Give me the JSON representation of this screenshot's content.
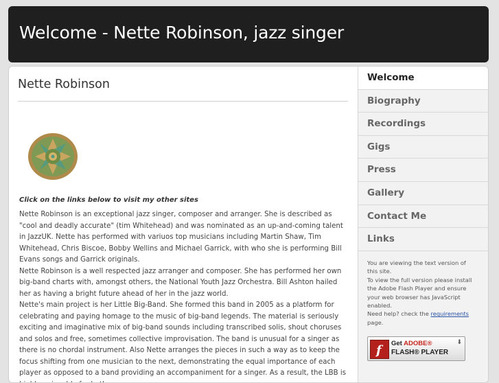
{
  "header": {
    "site_title": "Welcome - Nette Robinson, jazz singer"
  },
  "content": {
    "page_title": "Nette Robinson",
    "links_heading": "Click on the links below to visit my other sites",
    "paragraphs": [
      "Nette Robinson is an exceptional jazz singer, composer and arranger. She is described as \"cool and deadly accurate\" (tim Whitehead) and was nominated as an up-and-coming talent in JazzUK. Nette has performed with variuos top musicians including Martin Shaw, Tim Whitehead, Chris Biscoe, Bobby Wellins and Michael Garrick, with who she is performing Bill Evans songs and Garrick originals.",
      "Nette Robinson is a well respected jazz arranger and composer. She has performed her own big-band charts with, amongst others, the National Youth Jazz Orchestra. Bill Ashton hailed her as having a bright future ahead of her in the jazz world.",
      "Nette's main project is her Little Big-Band. She formed this band in 2005 as a platform for celebrating and paying homage to the music of big-band legends. The material is seriously exciting and imaginative mix of big-band sounds including transcribed solis, shout choruses and solos and free, sometimes collective improvisation. The band is unusual for a singer as there is no chordal instrument. Also Nette arranges the pieces in such a way as to keep the focus shifting from one musician to the next, demonstrating the equal importance of each player as opposed to a band providing an accompaniment for a singer. As a result, the LBB is highly enjoyable for both"
    ]
  },
  "nav": {
    "items": [
      {
        "label": "Welcome",
        "active": true
      },
      {
        "label": "Biography"
      },
      {
        "label": "Recordings"
      },
      {
        "label": "Gigs"
      },
      {
        "label": "Press"
      },
      {
        "label": "Gallery"
      },
      {
        "label": "Contact Me"
      },
      {
        "label": "Links"
      }
    ]
  },
  "sidebar": {
    "notice_line1": "You are viewing the text version of this site.",
    "notice_line2": "To view the full version please install the Adobe Flash Player and ensure your web browser has JavaScript enabled.",
    "help_prefix": "Need help? check the ",
    "help_link": "requirements",
    "help_suffix": " page.",
    "flash_get": "Get",
    "flash_adobe": "ADOBE®",
    "flash_player": "FLASH® PLAYER",
    "flash_icon_glyph": "f"
  },
  "colors": {
    "header_bg": "#1f1f1f",
    "page_bg": "#e3e3e3",
    "link": "#2a52a8",
    "adobe_red": "#c4251c"
  },
  "icons": {
    "logo": "mandala-logo-icon",
    "flash": "flash-player-icon",
    "download": "download-arrow-icon"
  }
}
